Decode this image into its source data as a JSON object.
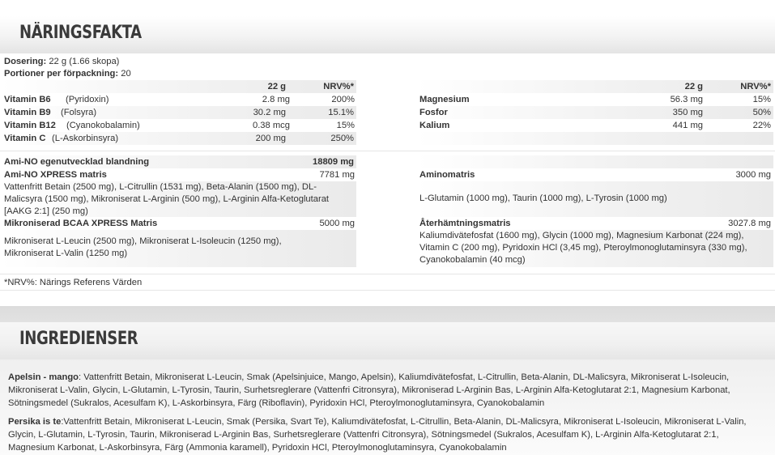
{
  "nutrition": {
    "title": "NÄRINGSFAKTA",
    "dosage_label": "Dosering:",
    "dosage_value": "22 g (1.66 skopa)",
    "servings_label": "Portioner per förpackning:",
    "servings_value": "20",
    "col_amount": "22 g",
    "col_nrv": "NRV%*",
    "vitamins": [
      {
        "name": "Vitamin B6",
        "sub": "(Pyridoxin)",
        "amount": "2.8 mg",
        "nrv": "200%"
      },
      {
        "name": "Vitamin B9",
        "sub": "(Folsyra)",
        "amount": "30.2 mg",
        "nrv": "15.1%"
      },
      {
        "name": "Vitamin B12",
        "sub": "(Cyanokobalamin)",
        "amount": "0.38 mcg",
        "nrv": "15%"
      },
      {
        "name": "Vitamin C",
        "sub": "(L-Askorbinsyra)",
        "amount": "200 mg",
        "nrv": "250%"
      }
    ],
    "minerals": [
      {
        "name": "Magnesium",
        "amount": "56.3 mg",
        "nrv": "15%"
      },
      {
        "name": "Fosfor",
        "amount": "350 mg",
        "nrv": "50%"
      },
      {
        "name": "Kalium",
        "amount": "441 mg",
        "nrv": "22%"
      }
    ],
    "blend_name": "Ami-NO egenutvecklad blandning",
    "blend_amount": "18809 mg",
    "xpress_name": "Ami-NO XPRESS matris",
    "xpress_amount": "7781 mg",
    "xpress_contents": "Vattenfritt Betain (2500 mg), L-Citrullin (1531 mg), Beta-Alanin (1500 mg), DL-Malicsyra (1500 mg), Mikroniserat L-Arginin (500 mg), L-Arginin Alfa-Ketoglutarat [AAKG 2:1] (250 mg)",
    "bcaa_name": "Mikroniserad BCAA XPRESS Matris",
    "bcaa_amount": "5000 mg",
    "bcaa_contents": "Mikroniserat L-Leucin (2500 mg), Mikroniserat L-Isoleucin (1250 mg), Mikroniserat L-Valin (1250 mg)",
    "amino_name": "Aminomatris",
    "amino_amount": "3000 mg",
    "amino_contents": "L-Glutamin (1000 mg), Taurin (1000 mg), L-Tyrosin (1000 mg)",
    "recovery_name": "Återhämtningsmatris",
    "recovery_amount": "3027.8 mg",
    "recovery_contents": "Kaliumdivätefosfat (1600 mg), Glycin (1000 mg), Magnesium Karbonat (224 mg), Vitamin C (200 mg), Pyridoxin HCl (3,45 mg), Pteroylmonoglutaminsyra (330 mg), Cyanokobalamin (40 mcg)",
    "footnote": "*NRV%: Närings Referens Värden"
  },
  "ingredients": {
    "title": "INGREDIENSER",
    "flavors": [
      {
        "label": "Apelsin - mango",
        "text": ": Vattenfritt Betain, Mikroniserat L-Leucin, Smak (Apelsinjuice, Mango, Apelsin), Kaliumdivätefosfat, L-Citrullin, Beta-Alanin, DL-Malicsyra, Mikroniserat L-Isoleucin, Mikroniserat L-Valin, Glycin, L-Glutamin, L-Tyrosin, Taurin, Surhetsreglerare (Vattenfri Citronsyra), Mikroniserad L-Arginin Bas, L-Arginin Alfa-Ketoglutarat 2:1, Magnesium Karbonat, Sötningsmedel (Sukralos, Acesulfam K), L-Askorbinsyra, Färg (Riboflavin), Pyridoxin HCl, Pteroylmonoglutaminsyra, Cyanokobalamin"
      },
      {
        "label": "Persika is te",
        "text": ":Vattenfritt Betain, Mikroniserat L-Leucin, Smak (Persika, Svart Te), Kaliumdivätefosfat, L-Citrullin, Beta-Alanin, DL-Malicsyra, Mikroniserat L-Isoleucin, Mikroniserat L-Valin, Glycin, L-Glutamin, L-Tyrosin, Taurin, Mikroniserad L-Arginin Bas, Surhetsreglerare (Vattenfri Citronsyra), Sötningsmedel (Sukralos, Acesulfam K), L-Arginin Alfa-Ketoglutarat 2:1, Magnesium Karbonat, L-Askorbinsyra, Färg (Ammonia karamell), Pyridoxin HCl, Pteroylmonoglutaminsyra, Cyanokobalamin"
      }
    ]
  }
}
